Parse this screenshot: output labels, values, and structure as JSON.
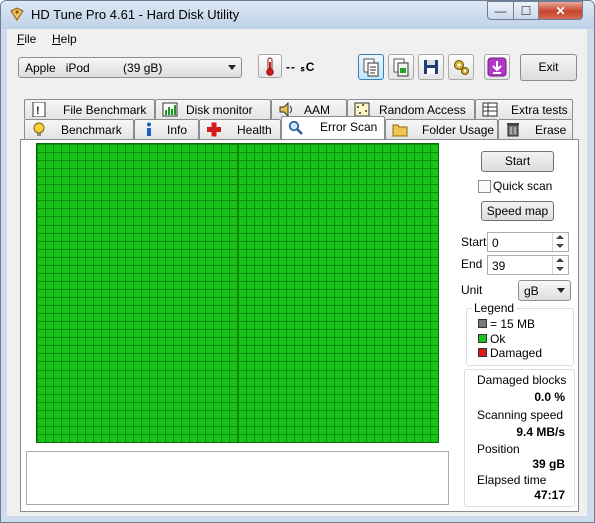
{
  "window": {
    "title": "HD Tune Pro 4.61 - Hard Disk Utility",
    "controls": {
      "minimize": "—",
      "maximize": "☐",
      "close": "✕"
    }
  },
  "menu": [
    {
      "underline": "F",
      "rest": "ile"
    },
    {
      "underline": "H",
      "rest": "elp"
    }
  ],
  "toolbar": {
    "drive": "Apple   iPod          (39 gB)",
    "temperature": "-- ₛC",
    "buttons": [
      "copy-info-icon",
      "copy-screenshot-icon",
      "save-icon",
      "options-icon",
      "download-icon"
    ],
    "exit_label": "Exit"
  },
  "tabs": {
    "row1": [
      {
        "label": "File Benchmark",
        "icon": "file-benchmark-icon"
      },
      {
        "label": "Disk monitor",
        "icon": "disk-monitor-icon"
      },
      {
        "label": "AAM",
        "icon": "speaker-icon"
      },
      {
        "label": "Random Access",
        "icon": "random-access-icon"
      },
      {
        "label": "Extra tests",
        "icon": "extra-tests-icon"
      }
    ],
    "row2": [
      {
        "label": "Benchmark",
        "icon": "benchmark-icon"
      },
      {
        "label": "Info",
        "icon": "info-icon"
      },
      {
        "label": "Health",
        "icon": "health-cross-icon"
      },
      {
        "label": "Error Scan",
        "icon": "magnifier-icon",
        "active": true
      },
      {
        "label": "Folder Usage",
        "icon": "folder-icon"
      },
      {
        "label": "Erase",
        "icon": "trash-icon"
      }
    ]
  },
  "scan": {
    "start_label": "Start",
    "quick_scan_label": "Quick scan",
    "quick_scan_checked": false,
    "speed_map_label": "Speed map",
    "start_field_label": "Start",
    "start_value": "0",
    "end_field_label": "End",
    "end_value": "39",
    "unit_label": "Unit",
    "unit_value": "gB",
    "grid": {
      "columns": 50,
      "rows": 37,
      "status": "Ok"
    }
  },
  "legend": {
    "title": "Legend",
    "items": [
      {
        "label": "= 15 MB",
        "color": "#7a7a7a"
      },
      {
        "label": "Ok",
        "color": "#19c219"
      },
      {
        "label": "Damaged",
        "color": "#e01818"
      }
    ]
  },
  "stats": {
    "damaged_label": "Damaged blocks",
    "damaged_value": "0.0 %",
    "speed_label": "Scanning speed",
    "speed_value": "9.4 MB/s",
    "position_label": "Position",
    "position_value": "39 gB",
    "elapsed_label": "Elapsed time",
    "elapsed_value": "47:17"
  },
  "colors": {
    "ok": "#19c219",
    "grid_line": "#0a8d0a",
    "damaged": "#e01818"
  }
}
